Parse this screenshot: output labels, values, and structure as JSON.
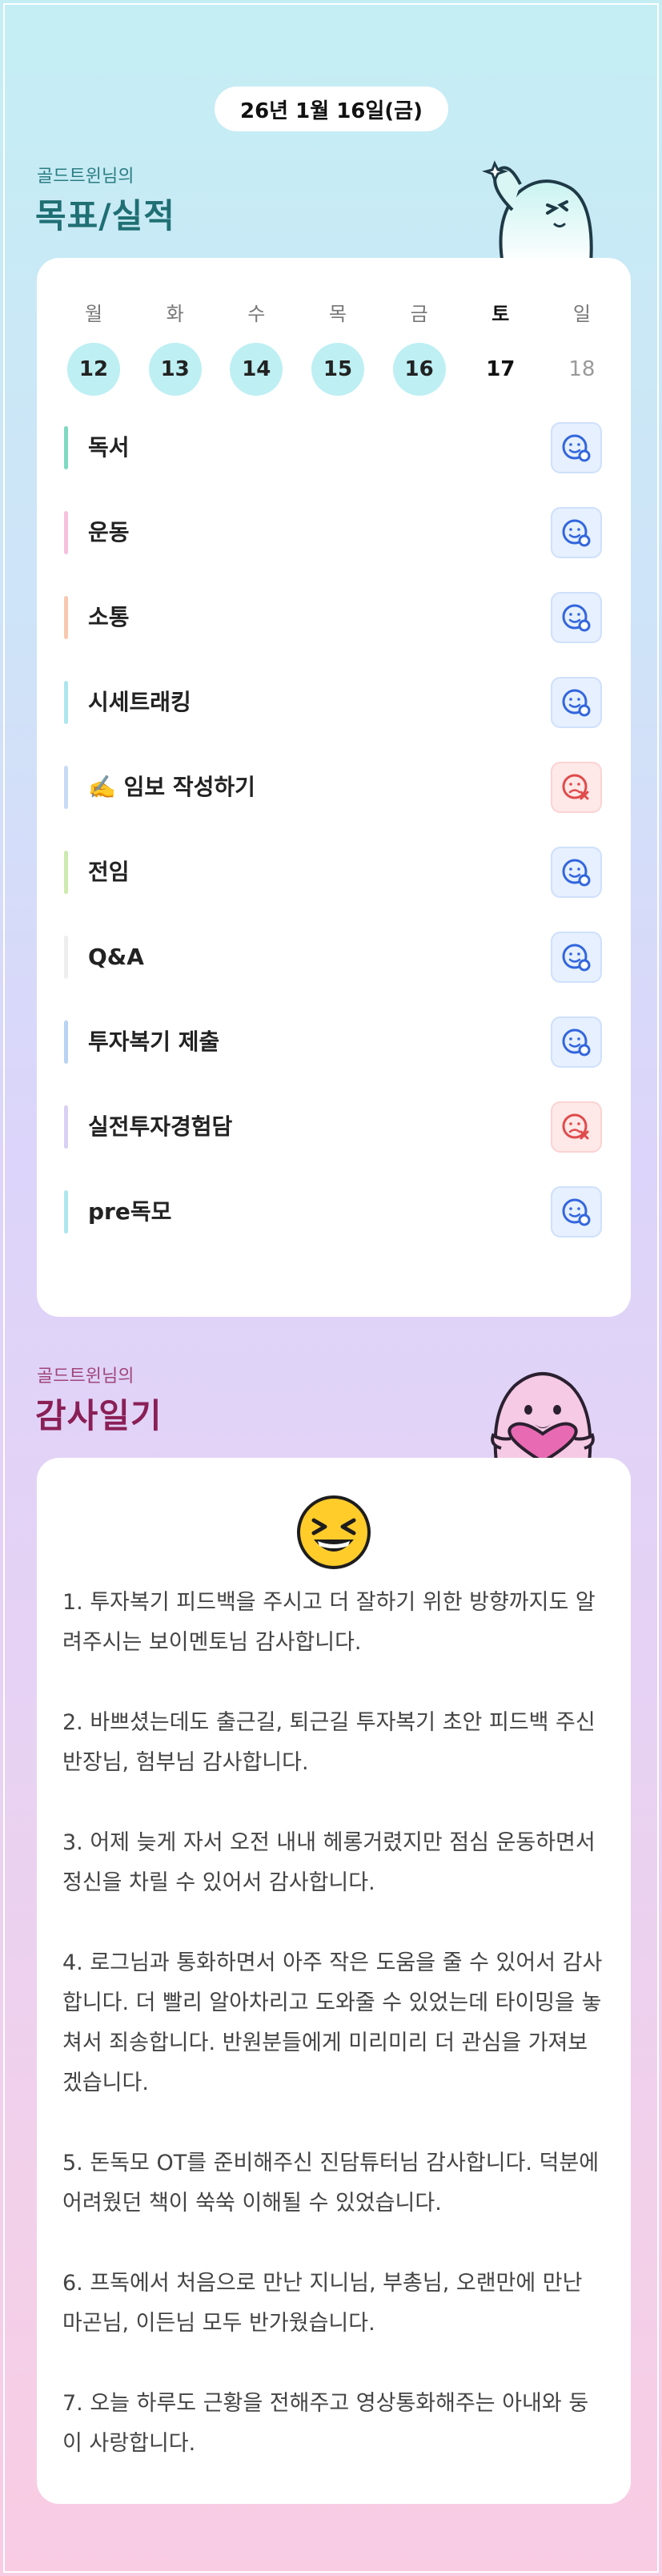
{
  "header": {
    "date_label": "26년 1월 16일(금)"
  },
  "goals_section": {
    "owner_label": "골드트윈님의",
    "title": "목표/실적"
  },
  "week": {
    "days": [
      {
        "weekday": "월",
        "date": "12",
        "state": "done"
      },
      {
        "weekday": "화",
        "date": "13",
        "state": "done"
      },
      {
        "weekday": "수",
        "date": "14",
        "state": "done"
      },
      {
        "weekday": "목",
        "date": "15",
        "state": "done"
      },
      {
        "weekday": "금",
        "date": "16",
        "state": "done"
      },
      {
        "weekday": "토",
        "date": "17",
        "state": "today"
      },
      {
        "weekday": "일",
        "date": "18",
        "state": "future"
      }
    ]
  },
  "goals": [
    {
      "label": "독서",
      "status": "success",
      "color": "#7ed9c2"
    },
    {
      "label": "운동",
      "status": "success",
      "color": "#f7c0dd"
    },
    {
      "label": "소통",
      "status": "success",
      "color": "#f8c9b0"
    },
    {
      "label": "시세트래킹",
      "status": "success",
      "color": "#aee6ee"
    },
    {
      "label": "✍️ 임보 작성하기",
      "status": "fail",
      "color": "#c9daf6"
    },
    {
      "label": "전임",
      "status": "success",
      "color": "#cdeab0"
    },
    {
      "label": "Q&A",
      "status": "success",
      "color": "#eeeeee"
    },
    {
      "label": "투자복기 제출",
      "status": "success",
      "color": "#b9d3f3"
    },
    {
      "label": "실전투자경험담",
      "status": "fail",
      "color": "#d9d0f5"
    },
    {
      "label": "pre독모",
      "status": "success",
      "color": "#aee6ee"
    }
  ],
  "diary_section": {
    "owner_label": "골드트윈님의",
    "title": "감사일기"
  },
  "diary": {
    "emoji": "😆",
    "entries": [
      "1. 투자복기 피드백을 주시고 더 잘하기 위한 방향까지도 알려주시는 보이멘토님 감사합니다.",
      "2. 바쁘셨는데도 출근길, 퇴근길 투자복기 초안 피드백 주신 반장님, 험부님 감사합니다.",
      "3. 어제 늦게 자서 오전 내내 헤롱거렸지만 점심 운동하면서 정신을 차릴 수 있어서 감사합니다.",
      "4. 로그님과 통화하면서 아주 작은 도움을 줄 수 있어서 감사합니다. 더 빨리 알아차리고 도와줄 수 있었는데 타이밍을 놓쳐서 죄송합니다. 반원분들에게 미리미리 더 관심을 가져보겠습니다.",
      "5. 돈독모 OT를 준비해주신 진담튜터님 감사합니다. 덕분에 어려웠던 책이 쑥쑥 이해될 수 있었습니다.",
      "6. 프독에서 처음으로 만난 지니님, 부총님, 오랜만에 만난 마곤님, 이든님 모두 반가웠습니다.",
      "7. 오늘 하루도 근황을 전해주고 영상통화해주는 아내와 둥이 사랑합니다."
    ]
  },
  "colors": {
    "goals_title": "#1f6f73",
    "diary_title": "#8a1f56",
    "success_icon": "#3366dd",
    "fail_icon": "#e04b4b"
  }
}
